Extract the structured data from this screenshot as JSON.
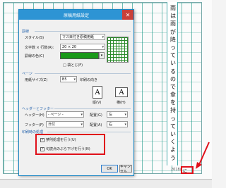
{
  "dialog": {
    "title": "原稿用紙設定",
    "close_glyph": "✕",
    "section_paper": "罫線",
    "style_label": "スタイル(S)",
    "style_value": "マス目付き原稿用紙",
    "chars_label": "文字数 × 行数(R):",
    "chars_value": "20 × 20",
    "color_label": "罫線の色(C)",
    "fold_label": "□ 袋とじ(F)",
    "section_page": "ページ",
    "size_label": "用紙サイズ(Z)",
    "size_value": "B5",
    "orient_label": "印刷の向き",
    "orient_vertical": "縦(V)",
    "orient_horizontal": "横(H)",
    "section_hf": "ヘッダーとフッター",
    "header_label": "ヘッダー(H)",
    "header_value": "- ページ -",
    "header_pos_label": "配置(G)",
    "header_pos_value": "左",
    "footer_label": "フッター(F)",
    "footer_value": "日付",
    "footer_pos_label": "配置(A)",
    "footer_pos_value": "右",
    "section_type": "印刷時の処理",
    "opt1_label": "禁則処理を行う(U)",
    "opt2_label": "句読点のぶら下げを行う(N)",
    "ok_label": "OK",
    "cancel_label": "キャンセル",
    "orient_a": "A"
  },
  "document": {
    "vertical_chars": [
      "雨",
      "は",
      "雨",
      "が",
      "降",
      "っ",
      "て",
      "い",
      "る",
      "の",
      "で",
      "傘",
      "を",
      "持",
      "っ",
      "て",
      "い",
      "く",
      "よ",
      "う"
    ],
    "footer_date": "2018/",
    "footer_end": "に"
  },
  "colors": {
    "title_bar": "#2d94d4",
    "highlight": "#e0101a",
    "grid_line": "#1a9a1a"
  }
}
